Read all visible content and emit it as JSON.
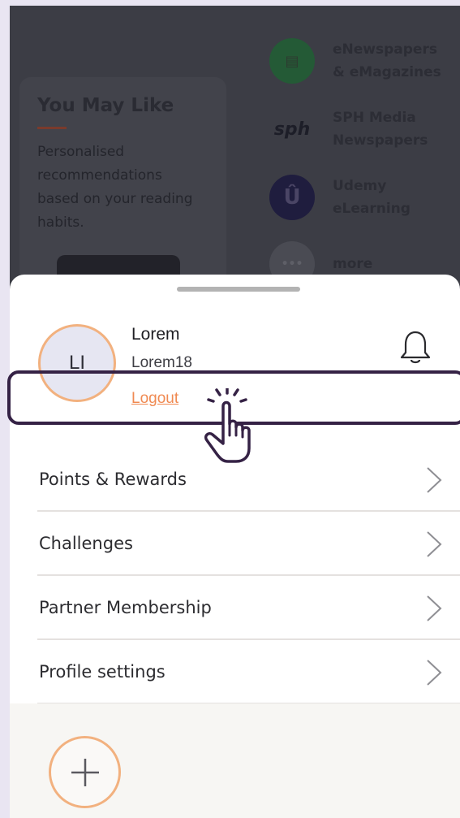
{
  "background": {
    "you_may_like": {
      "title": "You May Like",
      "description": "Personalised recommendations based on your reading habits."
    },
    "partners": [
      {
        "label": "eNewspapers\n& eMagazines",
        "icon": "news-icon"
      },
      {
        "label": "SPH Media\nNewspapers",
        "icon": "sph-logo"
      },
      {
        "label": "Udemy\neLearning",
        "icon": "udemy-logo"
      },
      {
        "label": "more",
        "icon": "more-icon"
      }
    ]
  },
  "profile": {
    "initials": "LI",
    "name": "Lorem",
    "username": "Lorem18",
    "logout_label": "Logout"
  },
  "menu": [
    {
      "label": "Points & Rewards"
    },
    {
      "label": "Challenges"
    },
    {
      "label": "Partner Membership"
    },
    {
      "label": "Profile settings"
    }
  ],
  "colors": {
    "accent": "#f08a52",
    "avatar_ring": "#f2b17f",
    "highlight": "#352245"
  }
}
